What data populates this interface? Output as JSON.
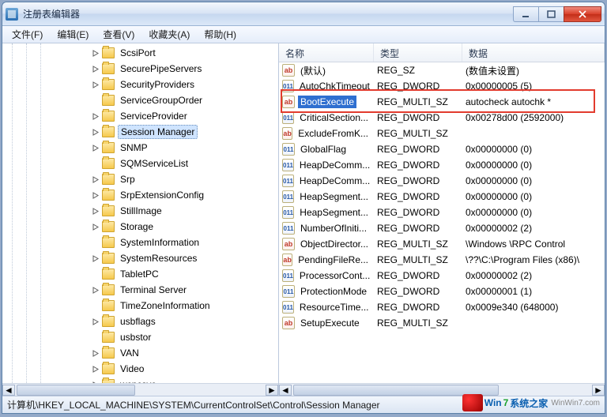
{
  "window": {
    "title": "注册表编辑器"
  },
  "menus": [
    {
      "label": "文件(F)"
    },
    {
      "label": "编辑(E)"
    },
    {
      "label": "查看(V)"
    },
    {
      "label": "收藏夹(A)"
    },
    {
      "label": "帮助(H)"
    }
  ],
  "tree": {
    "items": [
      {
        "label": "ScsiPort",
        "depth": 6,
        "exp": "closed"
      },
      {
        "label": "SecurePipeServers",
        "depth": 6,
        "exp": "closed"
      },
      {
        "label": "SecurityProviders",
        "depth": 6,
        "exp": "closed"
      },
      {
        "label": "ServiceGroupOrder",
        "depth": 6,
        "exp": "none"
      },
      {
        "label": "ServiceProvider",
        "depth": 6,
        "exp": "closed"
      },
      {
        "label": "Session Manager",
        "depth": 6,
        "exp": "closed",
        "selected": true
      },
      {
        "label": "SNMP",
        "depth": 6,
        "exp": "closed"
      },
      {
        "label": "SQMServiceList",
        "depth": 6,
        "exp": "none"
      },
      {
        "label": "Srp",
        "depth": 6,
        "exp": "closed"
      },
      {
        "label": "SrpExtensionConfig",
        "depth": 6,
        "exp": "closed"
      },
      {
        "label": "StillImage",
        "depth": 6,
        "exp": "closed"
      },
      {
        "label": "Storage",
        "depth": 6,
        "exp": "closed"
      },
      {
        "label": "SystemInformation",
        "depth": 6,
        "exp": "none"
      },
      {
        "label": "SystemResources",
        "depth": 6,
        "exp": "closed"
      },
      {
        "label": "TabletPC",
        "depth": 6,
        "exp": "none"
      },
      {
        "label": "Terminal Server",
        "depth": 6,
        "exp": "closed"
      },
      {
        "label": "TimeZoneInformation",
        "depth": 6,
        "exp": "none"
      },
      {
        "label": "usbflags",
        "depth": 6,
        "exp": "closed"
      },
      {
        "label": "usbstor",
        "depth": 6,
        "exp": "none"
      },
      {
        "label": "VAN",
        "depth": 6,
        "exp": "closed"
      },
      {
        "label": "Video",
        "depth": 6,
        "exp": "closed"
      },
      {
        "label": "wcncsvc",
        "depth": 6,
        "exp": "closed"
      }
    ]
  },
  "columns": {
    "name": "名称",
    "type": "类型",
    "data": "数据"
  },
  "values": [
    {
      "icon": "ab",
      "name": "(默认)",
      "type": "REG_SZ",
      "data": "(数值未设置)"
    },
    {
      "icon": "bin",
      "name": "AutoChkTimeout",
      "type": "REG_DWORD",
      "data": "0x00000005 (5)"
    },
    {
      "icon": "ab",
      "name": "BootExecute",
      "type": "REG_MULTI_SZ",
      "data": "autocheck autochk *",
      "selected": true
    },
    {
      "icon": "bin",
      "name": "CriticalSection...",
      "type": "REG_DWORD",
      "data": "0x00278d00 (2592000)"
    },
    {
      "icon": "ab",
      "name": "ExcludeFromK...",
      "type": "REG_MULTI_SZ",
      "data": ""
    },
    {
      "icon": "bin",
      "name": "GlobalFlag",
      "type": "REG_DWORD",
      "data": "0x00000000 (0)"
    },
    {
      "icon": "bin",
      "name": "HeapDeComm...",
      "type": "REG_DWORD",
      "data": "0x00000000 (0)"
    },
    {
      "icon": "bin",
      "name": "HeapDeComm...",
      "type": "REG_DWORD",
      "data": "0x00000000 (0)"
    },
    {
      "icon": "bin",
      "name": "HeapSegment...",
      "type": "REG_DWORD",
      "data": "0x00000000 (0)"
    },
    {
      "icon": "bin",
      "name": "HeapSegment...",
      "type": "REG_DWORD",
      "data": "0x00000000 (0)"
    },
    {
      "icon": "bin",
      "name": "NumberOfIniti...",
      "type": "REG_DWORD",
      "data": "0x00000002 (2)"
    },
    {
      "icon": "ab",
      "name": "ObjectDirector...",
      "type": "REG_MULTI_SZ",
      "data": "\\Windows \\RPC Control"
    },
    {
      "icon": "ab",
      "name": "PendingFileRe...",
      "type": "REG_MULTI_SZ",
      "data": "\\??\\C:\\Program Files (x86)\\"
    },
    {
      "icon": "bin",
      "name": "ProcessorCont...",
      "type": "REG_DWORD",
      "data": "0x00000002 (2)"
    },
    {
      "icon": "bin",
      "name": "ProtectionMode",
      "type": "REG_DWORD",
      "data": "0x00000001 (1)"
    },
    {
      "icon": "bin",
      "name": "ResourceTime...",
      "type": "REG_DWORD",
      "data": "0x0009e340 (648000)"
    },
    {
      "icon": "ab",
      "name": "SetupExecute",
      "type": "REG_MULTI_SZ",
      "data": ""
    }
  ],
  "statusbar": {
    "path": "计算机\\HKEY_LOCAL_MACHINE\\SYSTEM\\CurrentControlSet\\Control\\Session Manager"
  },
  "watermark": {
    "brand1": "Win",
    "brand2": "7",
    "brand3": "系统之家",
    "sub": "WinWin7.com"
  },
  "icon_labels": {
    "ab": "ab",
    "bin": "011\n110"
  }
}
